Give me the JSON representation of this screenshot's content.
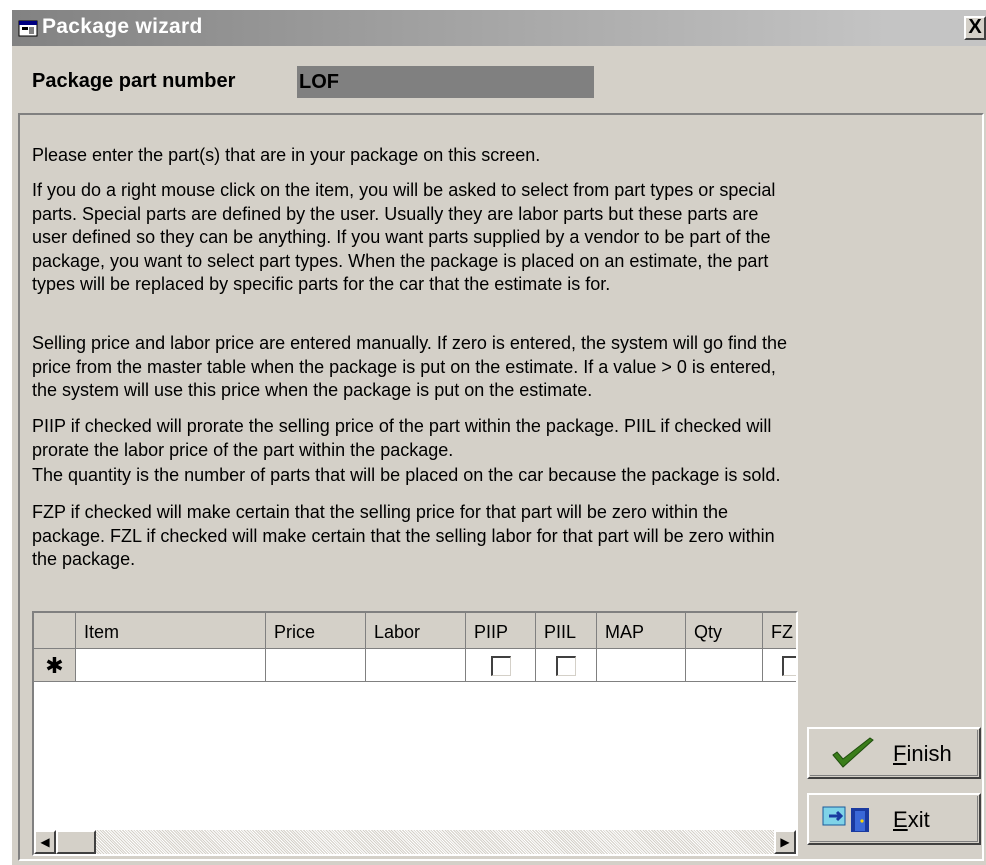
{
  "window": {
    "title": "Package wizard",
    "close_label": "X"
  },
  "package_part": {
    "label": "Package part number",
    "value": "LOF"
  },
  "instructions": [
    "Please enter the part(s) that are in your package on this screen.",
    "If you do a right mouse click on the item, you will be asked to select from part types or special\nparts.  Special parts are defined by the user.  Usually they are labor parts but these parts are\nuser defined so they can be anything.  If you want parts supplied by a vendor to be part of the\npackage, you want to select part types.  When the package is placed on an estimate, the part\ntypes will be replaced by specific parts for the car that the estimate is for.",
    "Selling price and labor price are entered manually.  If zero is entered, the system will go find the\nprice from the master table when the package is put on the estimate.  If a value > 0 is entered,\nthe system will use this price when the package is put on the estimate.",
    "PIIP if checked will prorate the selling price of the part within the package.  PIIL if checked will\nprorate the labor price of the part within the package.",
    "The quantity is the number of parts that will be placed on the car because the package is sold.",
    "FZP if checked will make certain that the selling price for that part will be zero within the\npackage.  FZL if checked will make certain that the selling labor for that part will be zero within\nthe package."
  ],
  "grid": {
    "columns": [
      "Item",
      "Price",
      "Labor",
      "PIIP",
      "PIIL",
      "MAP",
      "Qty",
      "FZ"
    ],
    "new_row_marker": "✱"
  },
  "scrollbar": {
    "left_arrow": "◀",
    "right_arrow": "▶"
  },
  "buttons": {
    "finish": {
      "mnemonic": "F",
      "rest": "inish"
    },
    "exit": {
      "mnemonic": "E",
      "rest": "xit"
    }
  },
  "colors": {
    "window_bg": "#d4d0c8",
    "title_gradient_start": "#828282",
    "part_field_bg": "#808080",
    "finish_check": "#3a7d1a",
    "exit_door": "#1a3aa0"
  }
}
